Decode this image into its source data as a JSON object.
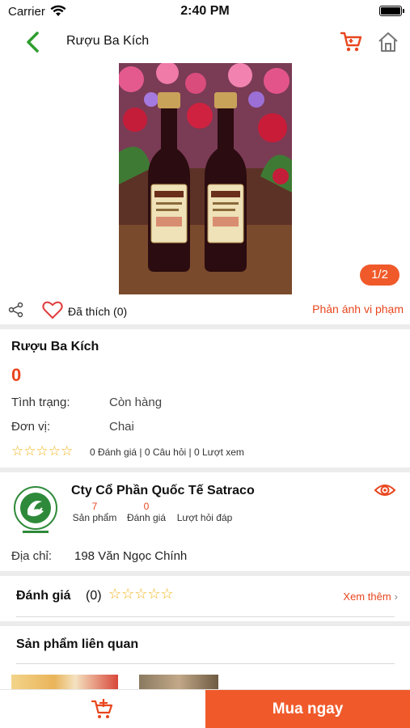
{
  "status_bar": {
    "carrier": "Carrier",
    "time": "2:40 PM"
  },
  "nav": {
    "title": "Rượu Ba Kích"
  },
  "gallery": {
    "pager": "1/2"
  },
  "actions": {
    "liked_label": "Đã thích (0)",
    "report_label": "Phản ánh vi phạm"
  },
  "product": {
    "name": "Rượu Ba Kích",
    "price": "0",
    "status_label": "Tình trạng:",
    "status_value": "Còn hàng",
    "unit_label": "Đơn vị:",
    "unit_value": "Chai",
    "stats_text": "0 Đánh giá |   0 Câu hỏi |   0 Lượt xem",
    "rating_stars": 0
  },
  "shop": {
    "name": "Cty Cổ Phần Quốc Tế Satraco",
    "products_count": "7",
    "products_label": "Sản phẩm",
    "reviews_count": "0",
    "reviews_label": "Đánh giá",
    "qa_label": "Lượt hỏi đáp",
    "address_label": "Địa chỉ:",
    "address_value": "198 Văn Ngọc Chính"
  },
  "reviews": {
    "title": "Đánh giá",
    "count": "(0)",
    "see_more": "Xem thêm"
  },
  "related": {
    "title": "Sản phẩm liên quan"
  },
  "bottom": {
    "buy_now": "Mua ngay"
  },
  "colors": {
    "accent": "#f05a2a",
    "back_green": "#2e9e2e",
    "star": "#f2b31a"
  }
}
